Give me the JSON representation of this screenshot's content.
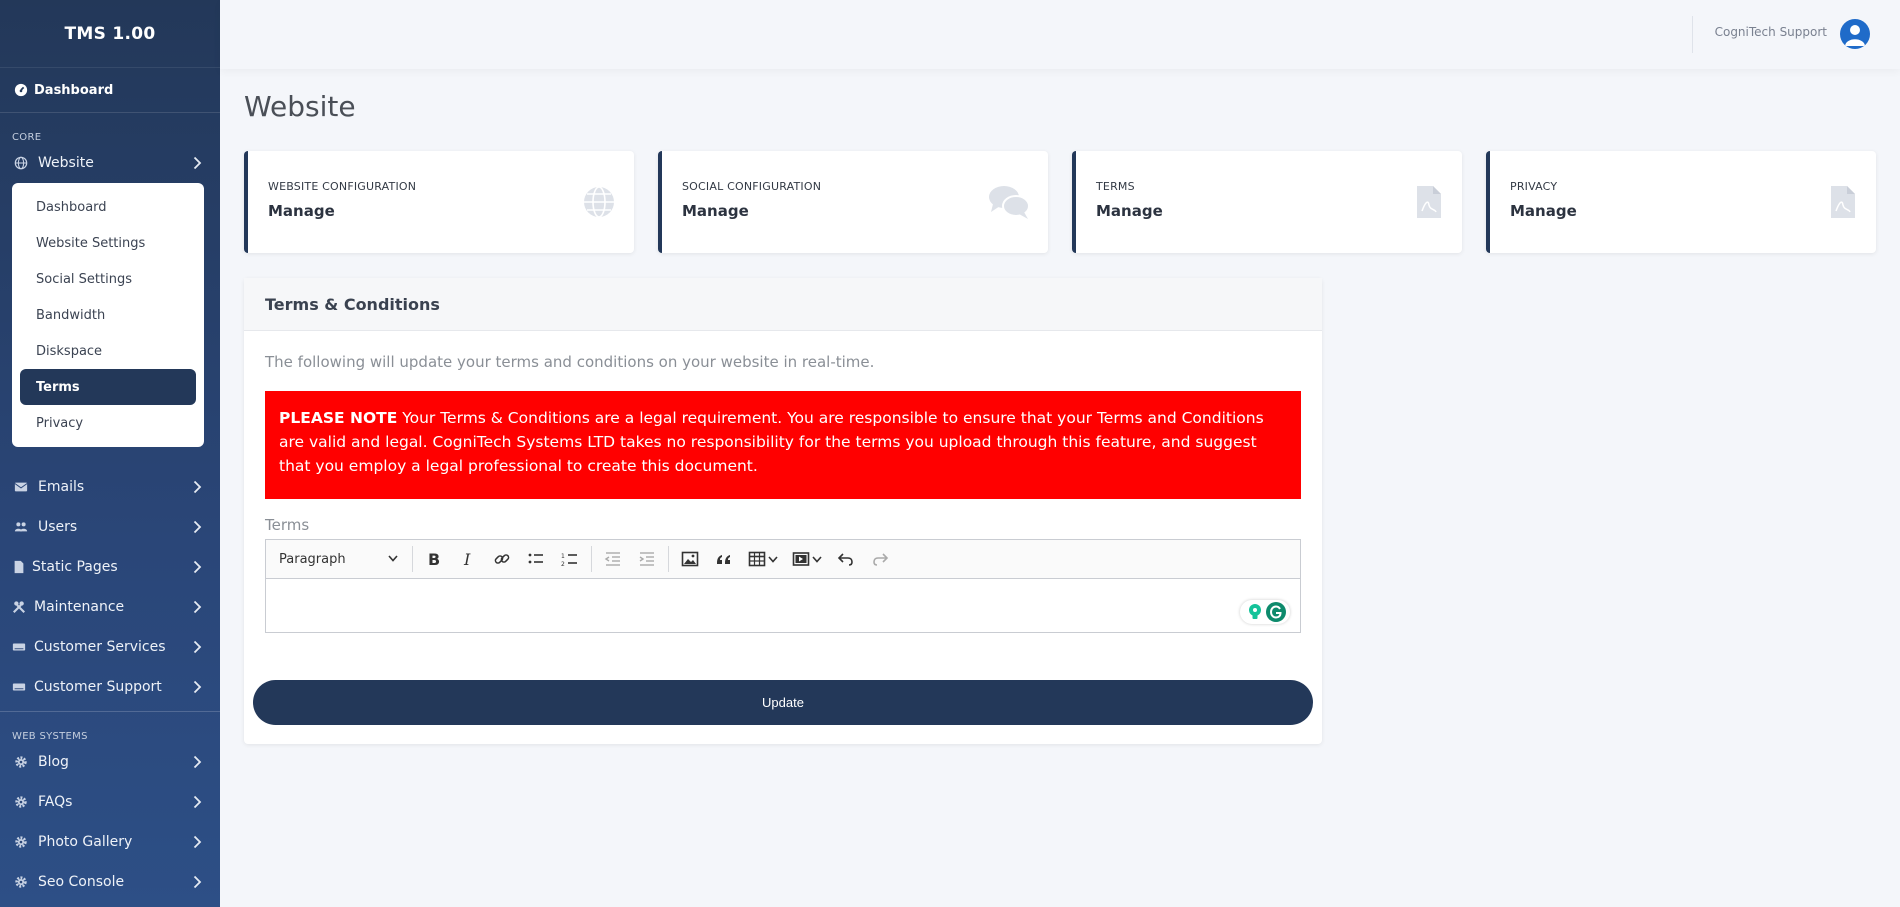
{
  "app": {
    "title": "TMS 1.00"
  },
  "sidebar": {
    "dashboard_label": "Dashboard",
    "core_heading": "CORE",
    "website_label": "Website",
    "submenu": [
      {
        "label": "Dashboard"
      },
      {
        "label": "Website Settings"
      },
      {
        "label": "Social Settings"
      },
      {
        "label": "Bandwidth"
      },
      {
        "label": "Diskspace"
      },
      {
        "label": "Terms",
        "active": true
      },
      {
        "label": "Privacy"
      }
    ],
    "items": [
      {
        "label": "Emails",
        "icon": "envelope-icon"
      },
      {
        "label": "Users",
        "icon": "users-icon"
      },
      {
        "label": "Static Pages",
        "icon": "file-icon"
      },
      {
        "label": "Maintenance",
        "icon": "tools-icon"
      },
      {
        "label": "Customer Services",
        "icon": "keyboard-icon"
      },
      {
        "label": "Customer Support",
        "icon": "keyboard-icon"
      }
    ],
    "websys_heading": "WEB SYSTEMS",
    "websys_items": [
      {
        "label": "Blog",
        "icon": "gear-icon"
      },
      {
        "label": "FAQs",
        "icon": "gear-icon"
      },
      {
        "label": "Photo Gallery",
        "icon": "gear-icon"
      },
      {
        "label": "Seo Console",
        "icon": "gear-icon"
      }
    ]
  },
  "topbar": {
    "user_name": "CogniTech Support"
  },
  "page": {
    "title": "Website"
  },
  "cards": [
    {
      "title": "WEBSITE CONFIGURATION",
      "value": "Manage",
      "icon": "globe-icon"
    },
    {
      "title": "SOCIAL CONFIGURATION",
      "value": "Manage",
      "icon": "comments-icon"
    },
    {
      "title": "TERMS",
      "value": "Manage",
      "icon": "pdf-file-icon"
    },
    {
      "title": "PRIVACY",
      "value": "Manage",
      "icon": "pdf-file-icon"
    }
  ],
  "terms_panel": {
    "header": "Terms & Conditions",
    "intro": "The following will update your terms and conditions on your website in real-time.",
    "alert_strong": "PLEASE NOTE",
    "alert_text": " Your Terms & Conditions are a legal requirement. You are responsible to ensure that your Terms and Conditions are valid and legal. CogniTech Systems LTD takes no responsibility for the terms you upload through this feature, and suggest that you employ a legal professional to create this document.",
    "field_label": "Terms",
    "editor": {
      "format_select": "Paragraph",
      "content": ""
    },
    "update_label": "Update"
  },
  "colors": {
    "primary": "#233859",
    "alert": "#ff0000",
    "accent_blue": "#1f6bc9"
  }
}
